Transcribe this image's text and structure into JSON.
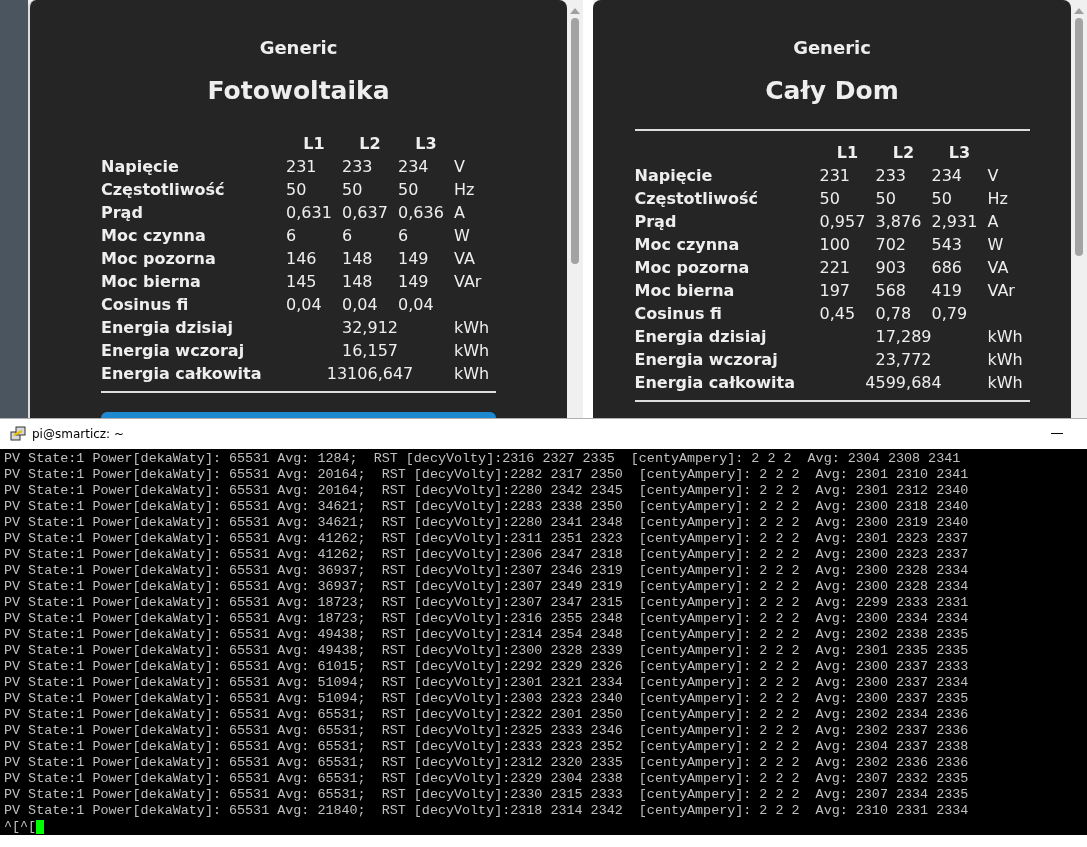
{
  "panels": [
    {
      "subtitle": "Generic",
      "title": "Fotowoltaika",
      "divider": false,
      "button_bar": true,
      "headers": [
        "L1",
        "L2",
        "L3"
      ],
      "rows": [
        {
          "kind": "phase",
          "label": "Napięcie",
          "values": [
            "231",
            "233",
            "234"
          ],
          "unit": "V"
        },
        {
          "kind": "phase",
          "label": "Częstotliwość",
          "values": [
            "50",
            "50",
            "50"
          ],
          "unit": "Hz"
        },
        {
          "kind": "phase",
          "label": "Prąd",
          "values": [
            "0,631",
            "0,637",
            "0,636"
          ],
          "unit": "A"
        },
        {
          "kind": "phase",
          "label": "Moc czynna",
          "values": [
            "6",
            "6",
            "6"
          ],
          "unit": "W"
        },
        {
          "kind": "phase",
          "label": "Moc pozorna",
          "values": [
            "146",
            "148",
            "149"
          ],
          "unit": "VA"
        },
        {
          "kind": "phase",
          "label": "Moc bierna",
          "values": [
            "145",
            "148",
            "149"
          ],
          "unit": "VAr"
        },
        {
          "kind": "phase",
          "label": "Cosinus fi",
          "values": [
            "0,04",
            "0,04",
            "0,04"
          ]
        },
        {
          "kind": "total",
          "label": "Energia dzisiaj",
          "value": "32,912",
          "unit": "kWh"
        },
        {
          "kind": "total",
          "label": "Energia wczoraj",
          "value": "16,157",
          "unit": "kWh"
        },
        {
          "kind": "total",
          "label": "Energia całkowita",
          "value": "13106,647",
          "unit": "kWh"
        }
      ]
    },
    {
      "subtitle": "Generic",
      "title": "Cały Dom",
      "divider": true,
      "button_bar": false,
      "headers": [
        "L1",
        "L2",
        "L3"
      ],
      "rows": [
        {
          "kind": "phase",
          "label": "Napięcie",
          "values": [
            "231",
            "233",
            "234"
          ],
          "unit": "V"
        },
        {
          "kind": "phase",
          "label": "Częstotliwość",
          "values": [
            "50",
            "50",
            "50"
          ],
          "unit": "Hz"
        },
        {
          "kind": "phase",
          "label": "Prąd",
          "values": [
            "0,957",
            "3,876",
            "2,931"
          ],
          "unit": "A"
        },
        {
          "kind": "phase",
          "label": "Moc czynna",
          "values": [
            "100",
            "702",
            "543"
          ],
          "unit": "W"
        },
        {
          "kind": "phase",
          "label": "Moc pozorna",
          "values": [
            "221",
            "903",
            "686"
          ],
          "unit": "VA"
        },
        {
          "kind": "phase",
          "label": "Moc bierna",
          "values": [
            "197",
            "568",
            "419"
          ],
          "unit": "VAr"
        },
        {
          "kind": "phase",
          "label": "Cosinus fi",
          "values": [
            "0,45",
            "0,78",
            "0,79"
          ]
        },
        {
          "kind": "total",
          "label": "Energia dzisiaj",
          "value": "17,289",
          "unit": "kWh"
        },
        {
          "kind": "total",
          "label": "Energia wczoraj",
          "value": "23,772",
          "unit": "kWh"
        },
        {
          "kind": "total",
          "label": "Energia całkowita",
          "value": "4599,684",
          "unit": "kWh"
        }
      ]
    }
  ],
  "terminal": {
    "title": "pi@smarticz: ~",
    "lines": [
      "PV State:1 Power[dekaWaty]: 65531 Avg: 1284;  RST [decyVolty]:2316 2327 2335  [centyAmpery]: 2 2 2  Avg: 2304 2308 2341",
      "PV State:1 Power[dekaWaty]: 65531 Avg: 20164;  RST [decyVolty]:2282 2317 2350  [centyAmpery]: 2 2 2  Avg: 2301 2310 2341",
      "PV State:1 Power[dekaWaty]: 65531 Avg: 20164;  RST [decyVolty]:2280 2342 2345  [centyAmpery]: 2 2 2  Avg: 2301 2312 2340",
      "PV State:1 Power[dekaWaty]: 65531 Avg: 34621;  RST [decyVolty]:2283 2338 2350  [centyAmpery]: 2 2 2  Avg: 2300 2318 2340",
      "PV State:1 Power[dekaWaty]: 65531 Avg: 34621;  RST [decyVolty]:2280 2341 2348  [centyAmpery]: 2 2 2  Avg: 2300 2319 2340",
      "PV State:1 Power[dekaWaty]: 65531 Avg: 41262;  RST [decyVolty]:2311 2351 2323  [centyAmpery]: 2 2 2  Avg: 2301 2323 2337",
      "PV State:1 Power[dekaWaty]: 65531 Avg: 41262;  RST [decyVolty]:2306 2347 2318  [centyAmpery]: 2 2 2  Avg: 2300 2323 2337",
      "PV State:1 Power[dekaWaty]: 65531 Avg: 36937;  RST [decyVolty]:2307 2346 2319  [centyAmpery]: 2 2 2  Avg: 2300 2328 2334",
      "PV State:1 Power[dekaWaty]: 65531 Avg: 36937;  RST [decyVolty]:2307 2349 2319  [centyAmpery]: 2 2 2  Avg: 2300 2328 2334",
      "PV State:1 Power[dekaWaty]: 65531 Avg: 18723;  RST [decyVolty]:2307 2347 2315  [centyAmpery]: 2 2 2  Avg: 2299 2333 2331",
      "PV State:1 Power[dekaWaty]: 65531 Avg: 18723;  RST [decyVolty]:2316 2355 2348  [centyAmpery]: 2 2 2  Avg: 2300 2334 2334",
      "PV State:1 Power[dekaWaty]: 65531 Avg: 49438;  RST [decyVolty]:2314 2354 2348  [centyAmpery]: 2 2 2  Avg: 2302 2338 2335",
      "PV State:1 Power[dekaWaty]: 65531 Avg: 49438;  RST [decyVolty]:2300 2328 2339  [centyAmpery]: 2 2 2  Avg: 2301 2335 2335",
      "PV State:1 Power[dekaWaty]: 65531 Avg: 61015;  RST [decyVolty]:2292 2329 2326  [centyAmpery]: 2 2 2  Avg: 2300 2337 2333",
      "PV State:1 Power[dekaWaty]: 65531 Avg: 51094;  RST [decyVolty]:2301 2321 2334  [centyAmpery]: 2 2 2  Avg: 2300 2337 2334",
      "PV State:1 Power[dekaWaty]: 65531 Avg: 51094;  RST [decyVolty]:2303 2323 2340  [centyAmpery]: 2 2 2  Avg: 2300 2337 2335",
      "PV State:1 Power[dekaWaty]: 65531 Avg: 65531;  RST [decyVolty]:2322 2301 2350  [centyAmpery]: 2 2 2  Avg: 2302 2334 2336",
      "PV State:1 Power[dekaWaty]: 65531 Avg: 65531;  RST [decyVolty]:2325 2333 2346  [centyAmpery]: 2 2 2  Avg: 2302 2337 2336",
      "PV State:1 Power[dekaWaty]: 65531 Avg: 65531;  RST [decyVolty]:2333 2323 2352  [centyAmpery]: 2 2 2  Avg: 2304 2337 2338",
      "PV State:1 Power[dekaWaty]: 65531 Avg: 65531;  RST [decyVolty]:2312 2320 2335  [centyAmpery]: 2 2 2  Avg: 2302 2336 2336",
      "PV State:1 Power[dekaWaty]: 65531 Avg: 65531;  RST [decyVolty]:2329 2304 2338  [centyAmpery]: 2 2 2  Avg: 2307 2332 2335",
      "PV State:1 Power[dekaWaty]: 65531 Avg: 65531;  RST [decyVolty]:2330 2315 2333  [centyAmpery]: 2 2 2  Avg: 2307 2334 2335",
      "PV State:1 Power[dekaWaty]: 65531 Avg: 21840;  RST [decyVolty]:2318 2314 2342  [centyAmpery]: 2 2 2  Avg: 2310 2331 2334"
    ],
    "prompt": "^[^["
  }
}
